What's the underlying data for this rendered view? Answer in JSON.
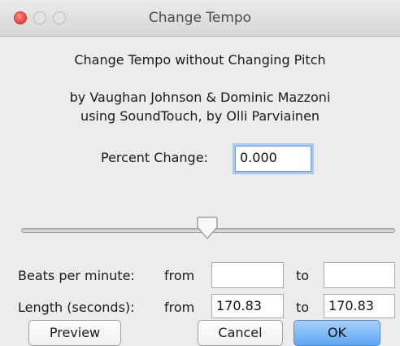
{
  "window": {
    "title": "Change Tempo"
  },
  "header": {
    "heading": "Change Tempo without Changing Pitch",
    "credits_line1": "by Vaughan Johnson & Dominic Mazzoni",
    "credits_line2": "using SoundTouch, by Olli Parviainen"
  },
  "percent_change": {
    "label": "Percent Change:",
    "value": "0.000"
  },
  "slider": {
    "position_fraction": 0.5
  },
  "beats_per_minute": {
    "label": "Beats per minute:",
    "from_label": "from",
    "from_value": "",
    "to_label": "to",
    "to_value": ""
  },
  "length_seconds": {
    "label": "Length (seconds):",
    "from_label": "from",
    "from_value": "170.83",
    "to_label": "to",
    "to_value": "170.83"
  },
  "buttons": {
    "preview": "Preview",
    "cancel": "Cancel",
    "ok": "OK"
  },
  "colors": {
    "close_button": "#e0443e",
    "default_button": "#5fa6f2",
    "focus_ring": "#a9c6ef"
  }
}
